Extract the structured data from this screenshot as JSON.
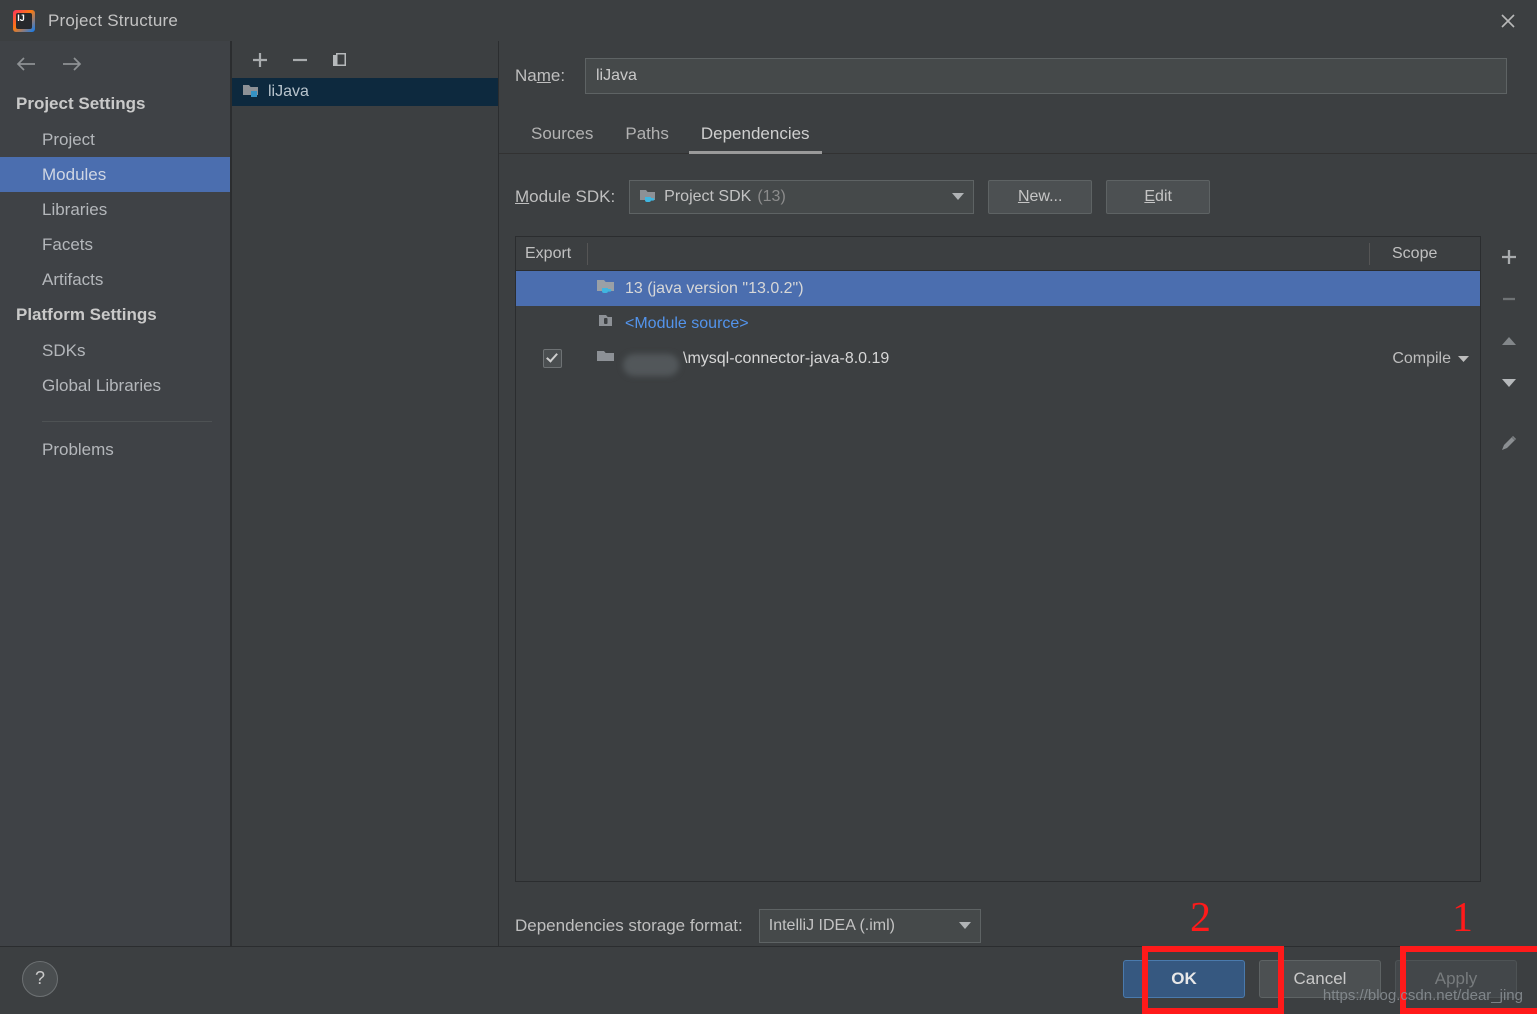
{
  "window": {
    "title": "Project Structure",
    "app_icon": "intellij-idea-icon",
    "close_icon": "close-icon"
  },
  "sidebar": {
    "back_icon": "arrow-left-icon",
    "forward_icon": "arrow-right-icon",
    "groups": [
      {
        "title": "Project Settings",
        "items": [
          {
            "label": "Project",
            "selected": false
          },
          {
            "label": "Modules",
            "selected": true
          },
          {
            "label": "Libraries",
            "selected": false
          },
          {
            "label": "Facets",
            "selected": false
          },
          {
            "label": "Artifacts",
            "selected": false
          }
        ]
      },
      {
        "title": "Platform Settings",
        "items": [
          {
            "label": "SDKs",
            "selected": false
          },
          {
            "label": "Global Libraries",
            "selected": false
          }
        ]
      }
    ],
    "extra_item": "Problems"
  },
  "module_panel": {
    "toolbar": {
      "add_icon": "plus-icon",
      "remove_icon": "minus-icon",
      "copy_icon": "copy-icon"
    },
    "modules": [
      {
        "label": "liJava",
        "icon": "module-folder-icon",
        "selected": true
      }
    ]
  },
  "detail": {
    "name_label": "Name:",
    "name_label_mnemonic": "m",
    "name_value": "liJava",
    "tabs": [
      {
        "label": "Sources",
        "active": false
      },
      {
        "label": "Paths",
        "active": false
      },
      {
        "label": "Dependencies",
        "active": true
      }
    ],
    "sdk": {
      "label": "Module SDK:",
      "label_mnemonic": "M",
      "value": "Project SDK",
      "value_suffix": "(13)",
      "icon": "jdk-folder-icon",
      "dropdown_icon": "chevron-down-icon",
      "new_button": "New...",
      "new_button_mnemonic": "N",
      "edit_button": "Edit",
      "edit_button_mnemonic": "E"
    },
    "table": {
      "columns": [
        "Export",
        "",
        "Scope"
      ],
      "rows": [
        {
          "export_checked": null,
          "icon": "jdk-folder-icon",
          "name": "13 (java version \"13.0.2\")",
          "name_style": "white",
          "scope": "",
          "selected": true,
          "blurred": false
        },
        {
          "export_checked": null,
          "icon": "module-source-icon",
          "name": "<Module source>",
          "name_style": "blue",
          "scope": "",
          "selected": false,
          "blurred": false
        },
        {
          "export_checked": true,
          "icon": "library-folder-icon",
          "name": "\\mysql-connector-java-8.0.19",
          "name_style": "white",
          "scope": "Compile",
          "scope_dropdown_icon": "caret-down-icon",
          "selected": false,
          "blurred": true
        }
      ]
    },
    "side_tools": [
      {
        "icon": "plus-icon",
        "name": "add-dependency-button"
      },
      {
        "icon": "minus-icon",
        "name": "remove-dependency-button"
      },
      {
        "icon": "caret-up-icon",
        "name": "move-up-button"
      },
      {
        "icon": "caret-down-icon",
        "name": "move-down-button"
      },
      {
        "icon": "pencil-icon",
        "name": "edit-dependency-button"
      }
    ],
    "storage": {
      "label": "Dependencies storage format:",
      "value": "IntelliJ IDEA (.iml)",
      "dropdown_icon": "chevron-down-icon"
    }
  },
  "footer": {
    "help_label": "?",
    "ok_label": "OK",
    "cancel_label": "Cancel",
    "apply_label": "Apply"
  },
  "annotations": {
    "marker_ok": "2",
    "marker_apply": "1",
    "color": "#ff1a1a",
    "watermark": "https://blog.csdn.net/dear_jing"
  }
}
